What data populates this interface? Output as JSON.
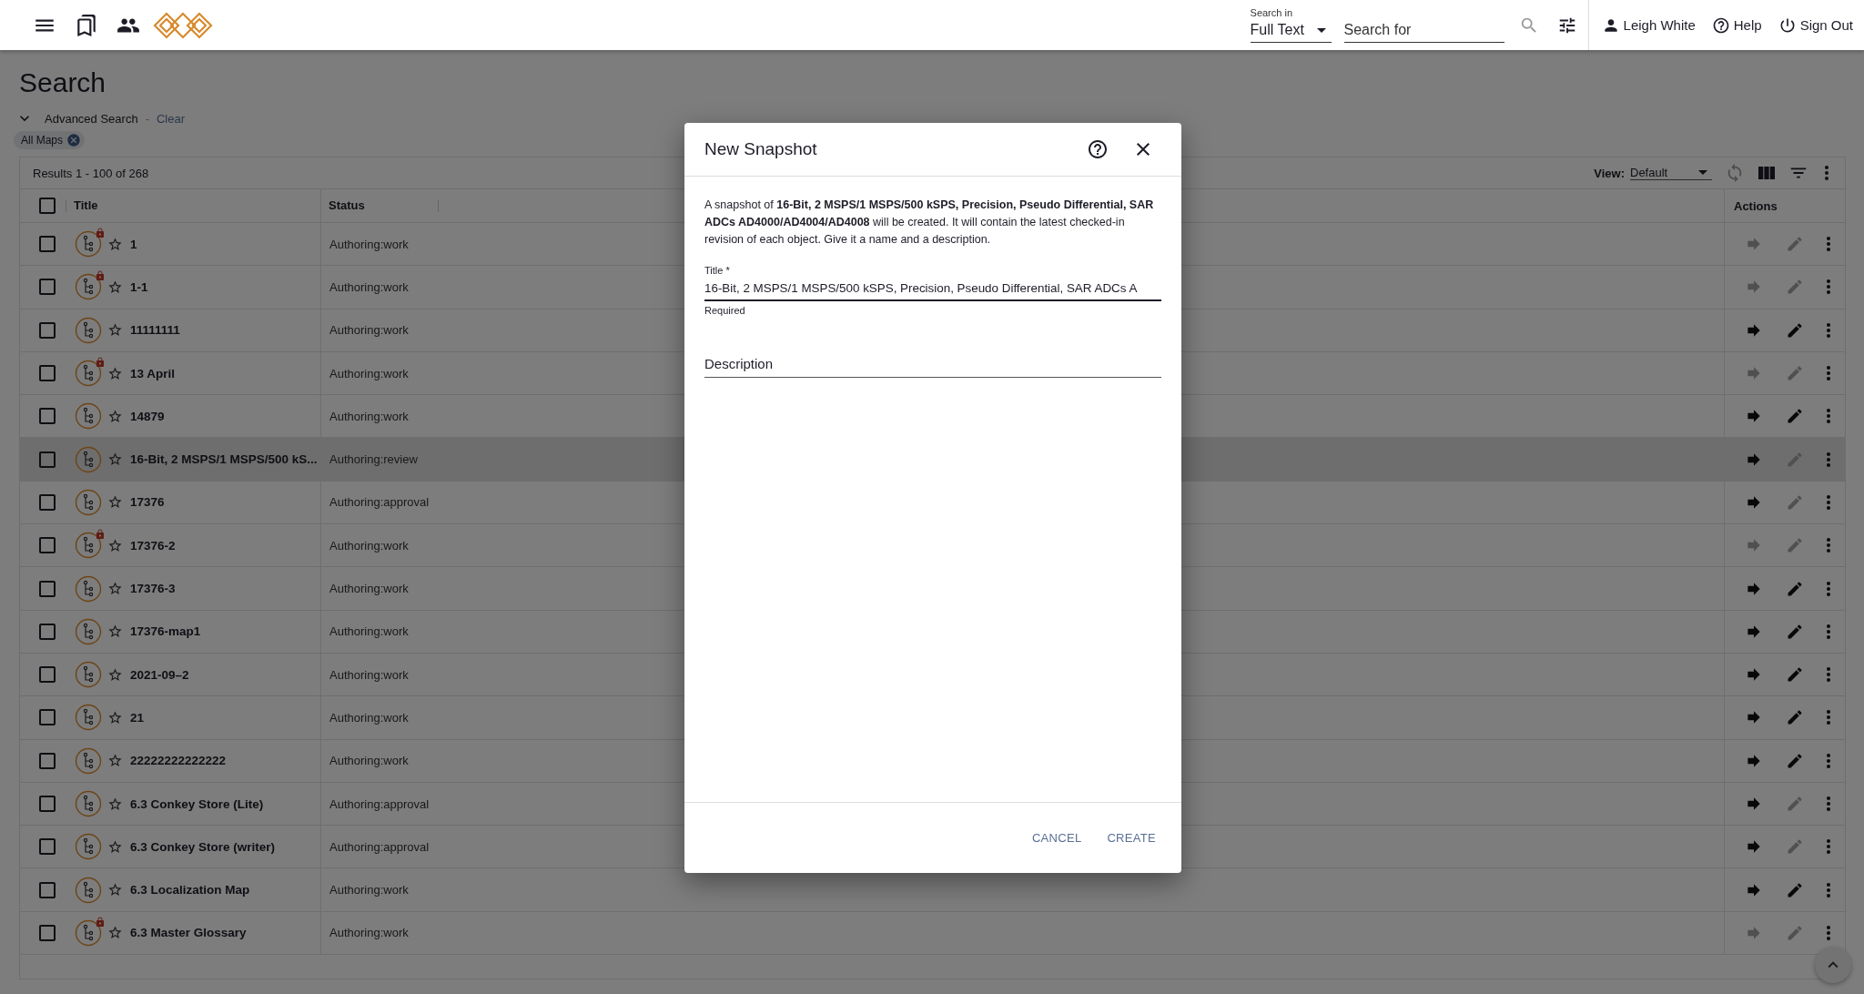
{
  "topbar": {
    "search_in_label": "Search in",
    "search_scope": "Full Text",
    "search_placeholder": "Search for",
    "user": "Leigh White",
    "help": "Help",
    "sign_out": "Sign Out"
  },
  "page": {
    "title": "Search",
    "advanced_search": "Advanced Search",
    "separator": "-",
    "clear": "Clear",
    "chips": [
      {
        "label": "All Maps"
      }
    ]
  },
  "results": {
    "summary": "Results 1 - 100 of 268",
    "view_label": "View:",
    "view_value": "Default",
    "refresh_disabled": true,
    "select_all_checked": false,
    "columns": [
      "Title",
      "Status"
    ],
    "actions_column": "Actions",
    "rows": [
      {
        "title": "1",
        "status": "Authoring:work",
        "locked": true,
        "checked": false,
        "hovered": false,
        "go_enabled": false,
        "edit_enabled": false
      },
      {
        "title": "1-1",
        "status": "Authoring:work",
        "locked": true,
        "checked": false,
        "hovered": false,
        "go_enabled": false,
        "edit_enabled": false
      },
      {
        "title": "11111111",
        "status": "Authoring:work",
        "locked": false,
        "checked": false,
        "hovered": false,
        "go_enabled": true,
        "edit_enabled": true
      },
      {
        "title": "13 April",
        "status": "Authoring:work",
        "locked": true,
        "checked": false,
        "hovered": false,
        "go_enabled": false,
        "edit_enabled": false
      },
      {
        "title": "14879",
        "status": "Authoring:work",
        "locked": false,
        "checked": false,
        "hovered": false,
        "go_enabled": true,
        "edit_enabled": true
      },
      {
        "title": "16-Bit, 2 MSPS/1 MSPS/500 kS...",
        "status": "Authoring:review",
        "locked": false,
        "checked": false,
        "hovered": true,
        "go_enabled": true,
        "edit_enabled": false
      },
      {
        "title": "17376",
        "status": "Authoring:approval",
        "locked": false,
        "checked": false,
        "hovered": false,
        "go_enabled": true,
        "edit_enabled": false
      },
      {
        "title": "17376-2",
        "status": "Authoring:work",
        "locked": true,
        "checked": false,
        "hovered": false,
        "go_enabled": false,
        "edit_enabled": false
      },
      {
        "title": "17376-3",
        "status": "Authoring:work",
        "locked": false,
        "checked": false,
        "hovered": false,
        "go_enabled": true,
        "edit_enabled": true
      },
      {
        "title": "17376-map1",
        "status": "Authoring:work",
        "locked": false,
        "checked": false,
        "hovered": false,
        "go_enabled": true,
        "edit_enabled": true
      },
      {
        "title": "2021-09–2",
        "status": "Authoring:work",
        "locked": false,
        "checked": false,
        "hovered": false,
        "go_enabled": true,
        "edit_enabled": true
      },
      {
        "title": "21",
        "status": "Authoring:work",
        "locked": false,
        "checked": false,
        "hovered": false,
        "go_enabled": true,
        "edit_enabled": true
      },
      {
        "title": "22222222222222",
        "status": "Authoring:work",
        "locked": false,
        "checked": false,
        "hovered": false,
        "go_enabled": true,
        "edit_enabled": true
      },
      {
        "title": "6.3 Conkey Store (Lite)",
        "status": "Authoring:approval",
        "locked": false,
        "checked": false,
        "hovered": false,
        "go_enabled": true,
        "edit_enabled": false
      },
      {
        "title": "6.3 Conkey Store (writer)",
        "status": "Authoring:approval",
        "locked": false,
        "checked": false,
        "hovered": false,
        "go_enabled": true,
        "edit_enabled": false
      },
      {
        "title": "6.3 Localization Map",
        "status": "Authoring:work",
        "locked": false,
        "checked": false,
        "hovered": false,
        "go_enabled": true,
        "edit_enabled": true
      },
      {
        "title": "6.3 Master Glossary",
        "status": "Authoring:work",
        "locked": true,
        "checked": false,
        "hovered": false,
        "go_enabled": false,
        "edit_enabled": false
      }
    ]
  },
  "dialog": {
    "title": "New Snapshot",
    "message": "A snapshot of **16-Bit, 2 MSPS/1 MSPS/500 kSPS, Precision, Pseudo Differential, SAR ADCs AD4000/AD4004/AD4008** will be created. It will contain the latest checked-in revision of each object. Give it a name and a description.",
    "title_label": "Title *",
    "title_value": "16-Bit, 2 MSPS/1 MSPS/500 kSPS, Precision, Pseudo Differential, SAR ADCs A",
    "title_helper": "Required",
    "description_placeholder": "Description",
    "buttons": [
      "CANCEL",
      "CREATE"
    ]
  }
}
